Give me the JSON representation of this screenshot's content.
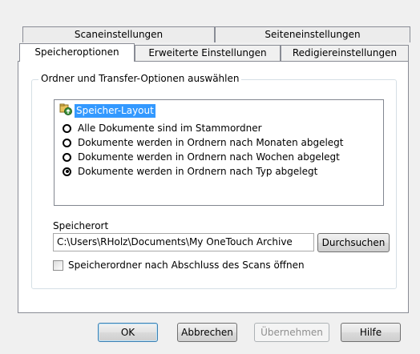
{
  "tabs": {
    "back_row": [
      {
        "label": "Scaneinstellungen"
      },
      {
        "label": "Seiteneinstellungen"
      }
    ],
    "front_row": [
      {
        "label": "Speicheroptionen",
        "active": true
      },
      {
        "label": "Erweiterte Einstellungen"
      },
      {
        "label": "Redigiereinstellungen"
      }
    ]
  },
  "group": {
    "title": "Ordner und Transfer-Optionen auswählen"
  },
  "layout_tree": {
    "icon": "storage-layout-icon",
    "title": "Speicher-Layout",
    "options": [
      {
        "label": "Alle Dokumente sind im Stammordner",
        "checked": false
      },
      {
        "label": "Dokumente werden in Ordnern nach Monaten abgelegt",
        "checked": false
      },
      {
        "label": "Dokumente werden in Ordnern nach Wochen abgelegt",
        "checked": false
      },
      {
        "label": "Dokumente werden in Ordnern nach Typ abgelegt",
        "checked": true
      }
    ]
  },
  "location": {
    "label": "Speicherort",
    "value": "C:\\Users\\RHolz\\Documents\\My OneTouch Archive",
    "browse_label": "Durchsuchen"
  },
  "open_after_scan": {
    "label": "Speicherordner nach Abschluss des Scans öffnen",
    "checked": false
  },
  "footer": {
    "ok_label": "OK",
    "cancel_label": "Abbrechen",
    "apply_label": "Übernehmen",
    "help_label": "Hilfe"
  }
}
